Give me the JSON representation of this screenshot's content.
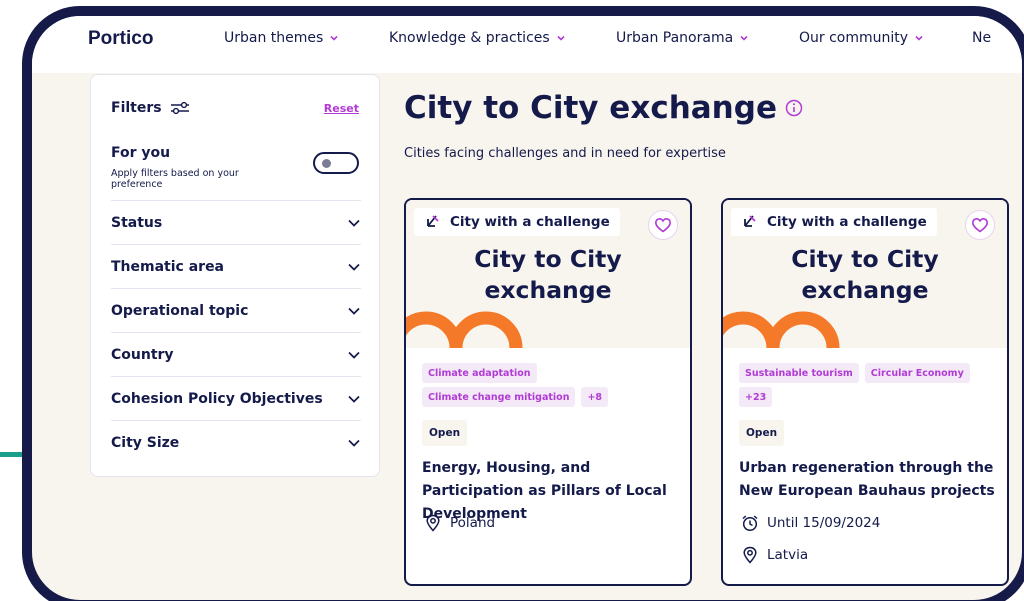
{
  "nav": {
    "logo": "Portico",
    "items": [
      {
        "label": "Urban themes"
      },
      {
        "label": "Knowledge & practices"
      },
      {
        "label": "Urban Panorama"
      },
      {
        "label": "Our community"
      },
      {
        "label": "Ne"
      }
    ]
  },
  "filters": {
    "title": "Filters",
    "reset": "Reset",
    "for_you": {
      "title": "For you",
      "subtitle": "Apply filters based on your preference",
      "enabled": false
    },
    "rows": [
      {
        "label": "Status"
      },
      {
        "label": "Thematic area"
      },
      {
        "label": "Operational topic"
      },
      {
        "label": "Country"
      },
      {
        "label": "Cohesion Policy Objectives"
      },
      {
        "label": "City Size"
      }
    ]
  },
  "main": {
    "title": "City to City exchange",
    "subtitle": "Cities facing challenges and in need for expertise"
  },
  "cards": [
    {
      "type_label": "City with a challenge",
      "banner_line1": "City to City",
      "banner_line2": "exchange",
      "tags": [
        "Climate adaptation",
        "Climate change mitigation",
        "+8"
      ],
      "status": "Open",
      "title": "Energy, Housing, and Participation as Pillars of Local Development",
      "deadline": "",
      "country": "Poland"
    },
    {
      "type_label": "City with a challenge",
      "banner_line1": "City to City",
      "banner_line2": "exchange",
      "tags": [
        "Sustainable tourism",
        "Circular Economy",
        "+23"
      ],
      "status": "Open",
      "title": "Urban regeneration through the New European Bauhaus projects",
      "deadline": "Until 15/09/2024",
      "country": "Latvia"
    }
  ],
  "colors": {
    "navy": "#141a4a",
    "accent_purple": "#b23bd6",
    "tag_bg": "#f3e9f7",
    "beige": "#f8f4ee",
    "orange": "#f47a2a",
    "teal": "#1aa08a"
  }
}
